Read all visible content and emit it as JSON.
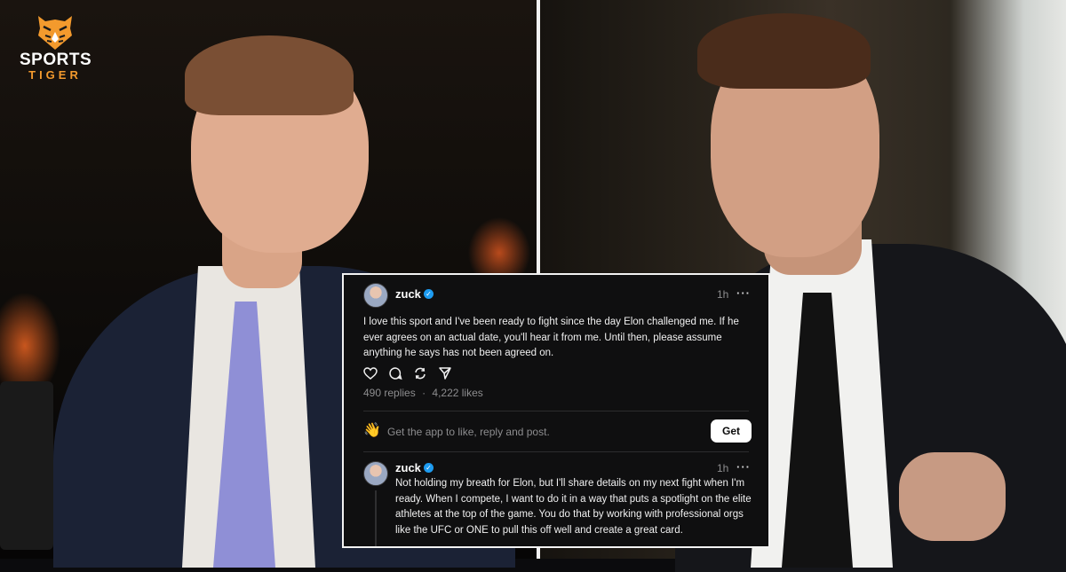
{
  "logo": {
    "line1": "SPORTS",
    "line2": "TIGER",
    "accent_color": "#f39a2d"
  },
  "posts": [
    {
      "username": "zuck",
      "verified": true,
      "time": "1h",
      "more_label": "···",
      "text": "I love this sport and I've been ready to fight since the day Elon challenged me. If he ever agrees on an actual date, you'll hear it from me. Until then, please assume anything he says has not been agreed on.",
      "replies": "490 replies",
      "separator": "·",
      "likes": "4,222 likes",
      "actions": [
        "heart-icon",
        "comment-icon",
        "repost-icon",
        "share-icon"
      ]
    },
    {
      "username": "zuck",
      "verified": true,
      "time": "1h",
      "more_label": "···",
      "text": "Not holding my breath for Elon, but I'll share details on my next fight when I'm ready. When I compete, I want to do it in a way that puts a spotlight on the elite athletes at the top of the game. You do that by working with professional orgs like the UFC or ONE to pull this off well and create a great card."
    }
  ],
  "promo": {
    "icon": "👋",
    "text": "Get the app to like, reply and post.",
    "button_label": "Get"
  },
  "colors": {
    "card_bg": "#0f0f10",
    "card_border": "#f2f2f2",
    "verified_blue": "#1d9bf0",
    "muted_text": "#8d8d8f"
  }
}
